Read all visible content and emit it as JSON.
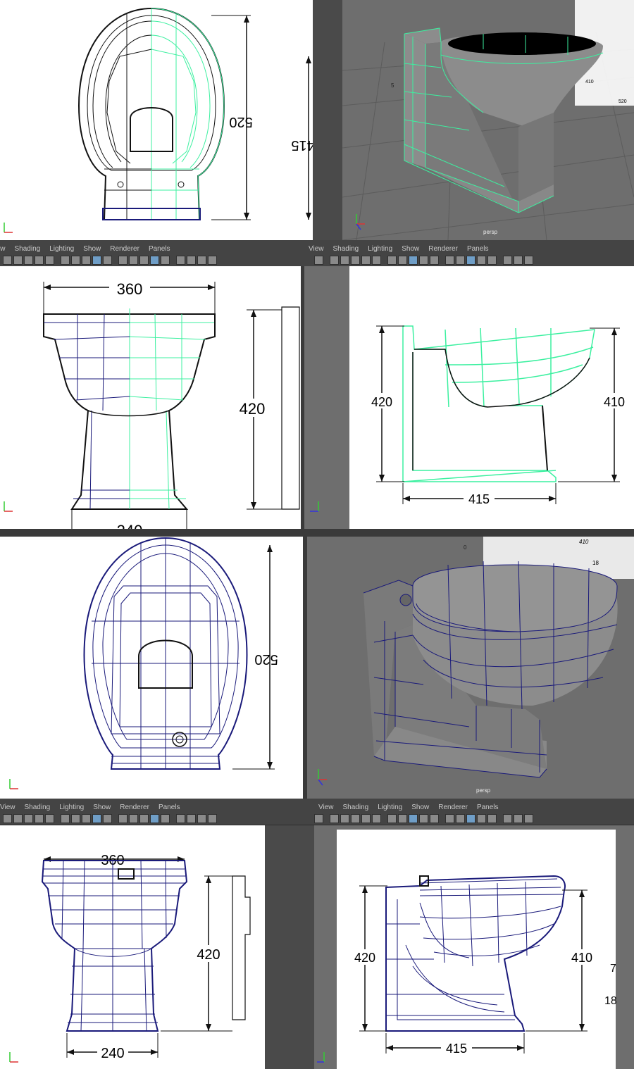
{
  "menu": {
    "view": "View",
    "shading": "Shading",
    "lighting": "Lighting",
    "show": "Show",
    "renderer": "Renderer",
    "panels": "Panels"
  },
  "camera": {
    "persp": "persp"
  },
  "colors": {
    "wire_selected": "#3cf0a0",
    "wire_blue": "#1a1a7a",
    "wire_black": "#111111",
    "viewport_gray": "#6e6e6e",
    "mesh_gray": "#8c8c8c",
    "ortho_bg": "#ffffff"
  },
  "dims": {
    "top_depth": "520",
    "top_side": "415",
    "front_width": "360",
    "front_height": "420",
    "front_base_clipped": "240",
    "side_left": "420",
    "side_right": "410",
    "side_base": "415",
    "top2_depth": "520",
    "front2_width": "360",
    "front2_height": "420",
    "front2_base": "240",
    "side2_left": "420",
    "side2_right": "410",
    "side2_base": "415",
    "ref_410": "410",
    "ref_415": "415",
    "ref_520": "520",
    "ref_420": "420",
    "ref_5": "5",
    "ref_18": "18",
    "ref_7": "7",
    "ref_0": "0"
  },
  "icons": [
    "select-icon",
    "lasso-icon",
    "camera-icon",
    "bookmark-icon",
    "grid-icon",
    "wireframe-icon",
    "smooth-shade-icon",
    "xray-icon",
    "light-icon",
    "isolate-icon",
    "hud-icon"
  ]
}
